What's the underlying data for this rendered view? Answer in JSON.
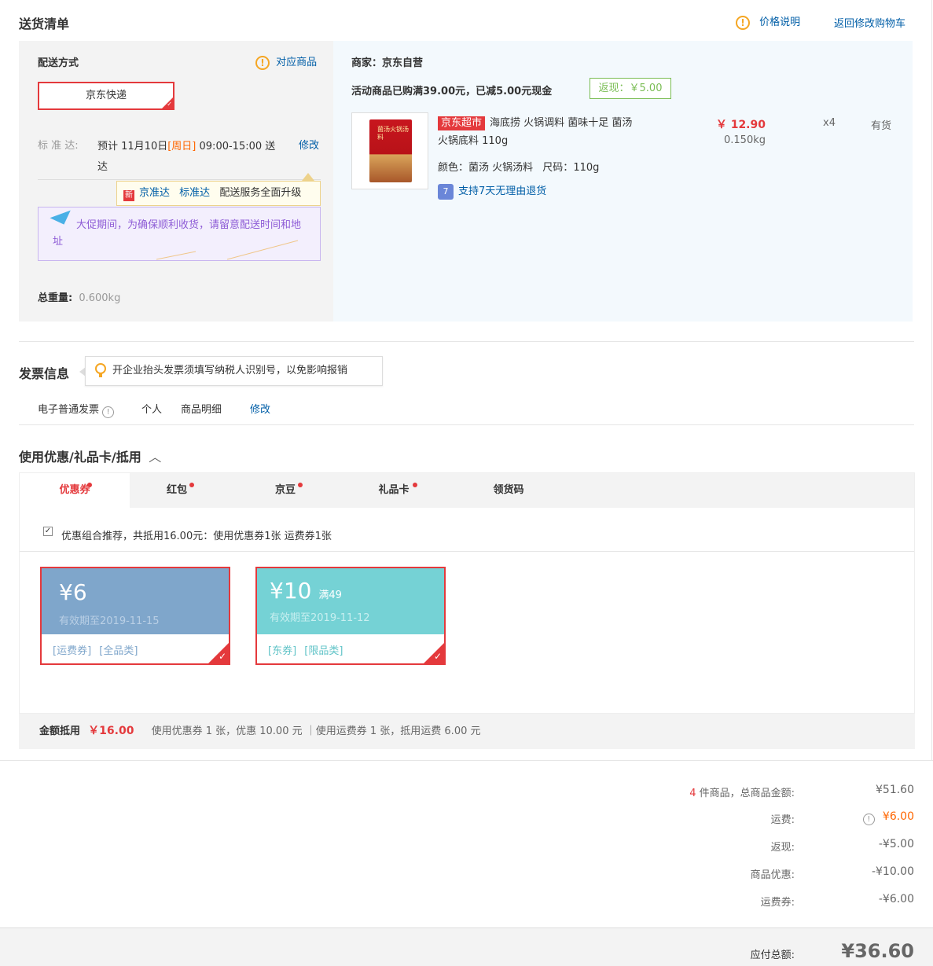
{
  "delivery": {
    "title": "送货清单",
    "price_note": "价格说明",
    "back_to_cart": "返回修改购物车",
    "method_label": "配送方式",
    "match_goods": "对应商品",
    "express_name": "京东快递",
    "std_label": "标 准 达:",
    "std_time_1": "预计 11月10日",
    "std_day": "[周日]",
    "std_time_2": "09:00-15:00 送",
    "std_time_3": "达",
    "modify": "修改",
    "jzd_tag": "新",
    "jzd_name": "京准达",
    "jzd_std": "标准达",
    "jzd_text": "配送服务全面升级",
    "promo_notice": "大促期间，为确保顺利收货，请留意配送时间和地址",
    "weight_label": "总重量:",
    "weight_value": "0.600kg"
  },
  "merchant": {
    "label": "商家：京东自营",
    "activity": "活动商品已购满39.00元，已减5.00元现金",
    "cashback": "返现：￥5.00"
  },
  "product": {
    "badge": "京东超市",
    "name_line1": "海底捞 火锅调料 菌味十足 菌汤",
    "name_line2": "火锅底料 110g",
    "spec_color_label": "颜色：",
    "spec_color": "菌汤 火锅汤料",
    "spec_size_label": "尺码：",
    "spec_size": "110g",
    "return_icon": "7",
    "return_policy": "支持7天无理由退货",
    "price": "￥ 12.90",
    "weight": "0.150kg",
    "qty": "x4",
    "stock": "有货",
    "package_text": "菌汤火锅汤料"
  },
  "invoice": {
    "title": "发票信息",
    "tip": "开企业抬头发票须填写纳税人识别号，以免影响报销",
    "type": "电子普通发票",
    "holder": "个人",
    "content": "商品明细",
    "modify": "修改"
  },
  "coupons": {
    "title": "使用优惠/礼品卡/抵用",
    "tabs": [
      "优惠券",
      "红包",
      "京豆",
      "礼品卡",
      "领货码"
    ],
    "recommend": "优惠组合推荐，共抵用16.00元：使用优惠券1张 运费券1张",
    "items": [
      {
        "amount": "¥6",
        "condition": "",
        "expiry": "有效期至2019-11-15",
        "tag1": "[运费券]",
        "tag2": "[全品类]",
        "color": "#7fa6cb"
      },
      {
        "amount": "¥10",
        "condition": "满49",
        "expiry": "有效期至2019-11-12",
        "tag1": "[东券]",
        "tag2": "[限品类]",
        "color": "#75d2d5"
      }
    ],
    "sum_label": "金额抵用",
    "sum_value": "￥16.00",
    "sum_detail": "使用优惠券 1 张，优惠 10.00 元 ｜使用运费券 1 张，抵用运费 6.00 元"
  },
  "totals": {
    "count": "4",
    "count_label": "件商品，总商品金额:",
    "goods_total": "¥51.60",
    "freight_label": "运费:",
    "freight": "¥6.00",
    "cashback_label": "返现:",
    "cashback": "-¥5.00",
    "discount_label": "商品优惠:",
    "discount": "-¥10.00",
    "freight_coupon_label": "运费券:",
    "freight_coupon": "-¥6.00",
    "pay_label": "应付总额:",
    "pay_total": "¥36.60"
  }
}
